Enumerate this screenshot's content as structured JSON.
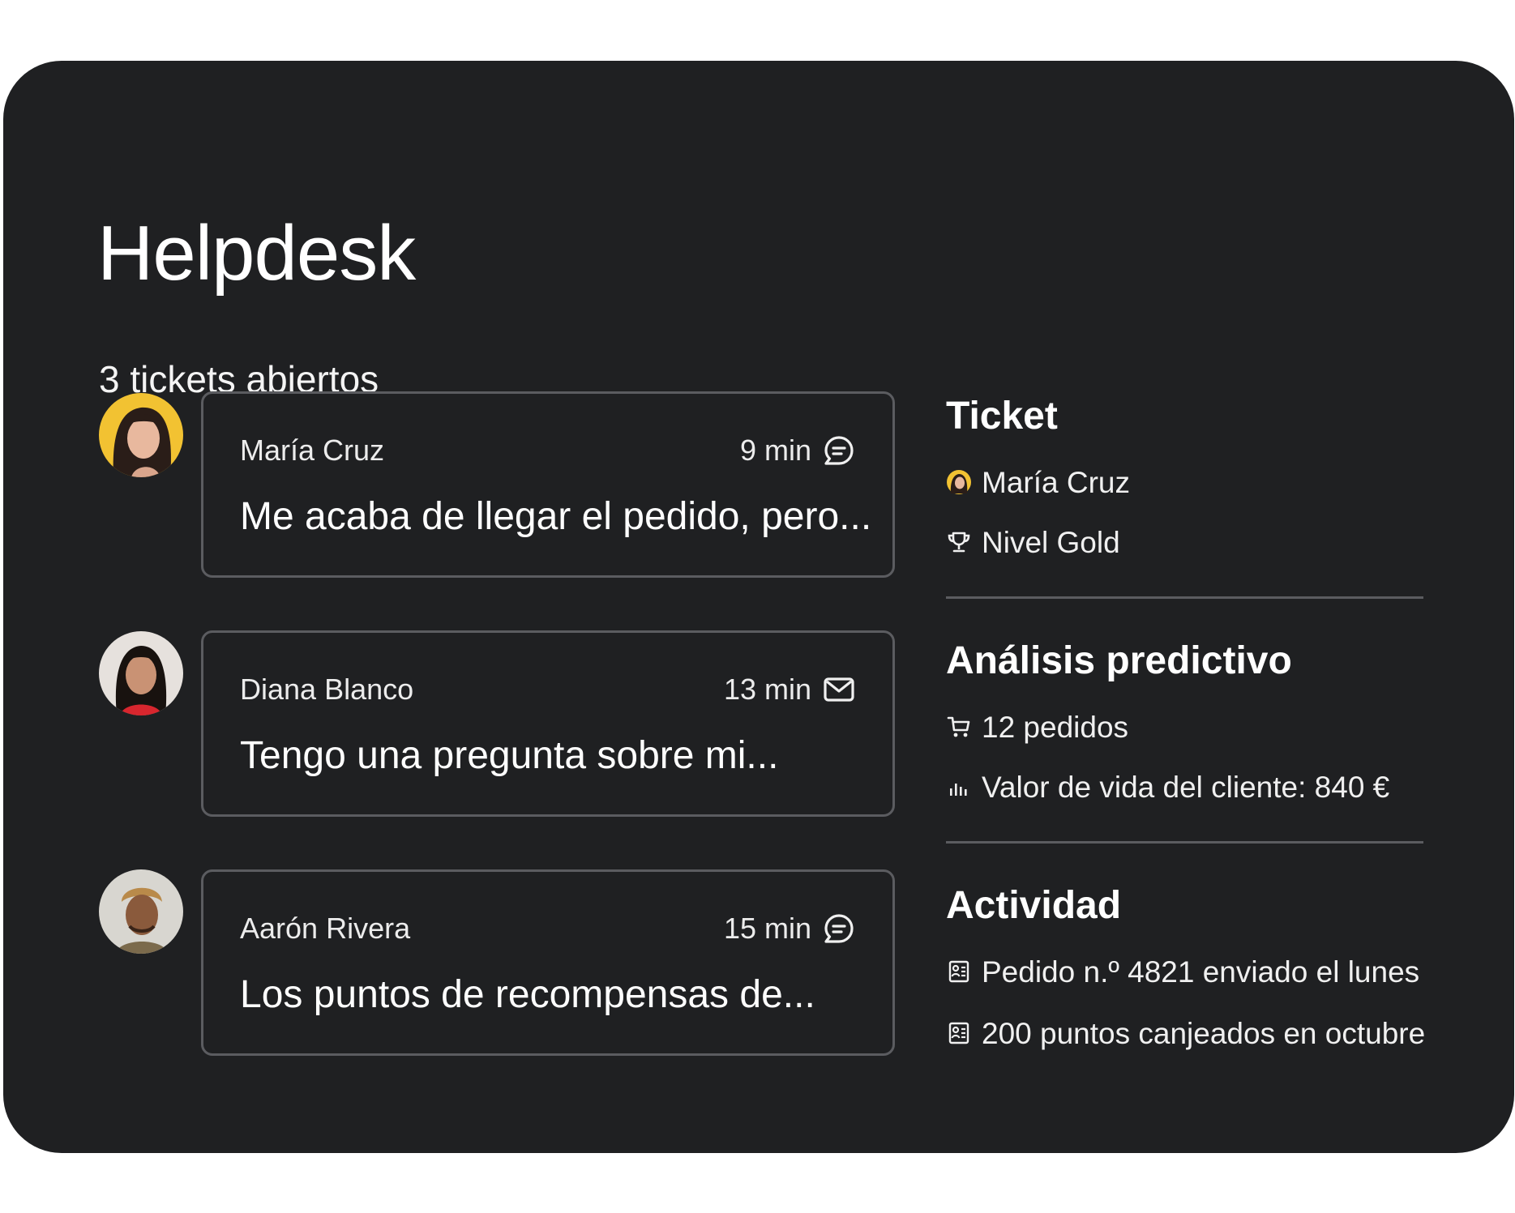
{
  "header": {
    "title": "Helpdesk",
    "subtitle": "3 tickets abiertos"
  },
  "tickets": [
    {
      "name": "María Cruz",
      "time": "9 min",
      "channel_icon": "chat-bubble-icon",
      "preview": "Me acaba de llegar el pedido, pero...",
      "avatar_bg": "#f2c232"
    },
    {
      "name": "Diana Blanco",
      "time": "13 min",
      "channel_icon": "envelope-icon",
      "preview": "Tengo una pregunta sobre mi...",
      "avatar_bg": "#e6e1dd"
    },
    {
      "name": "Aarón Rivera",
      "time": "15 min",
      "channel_icon": "chat-bubble-icon",
      "preview": "Los puntos de recompensas de...",
      "avatar_bg": "#d8d6d0"
    }
  ],
  "details": {
    "ticket": {
      "title": "Ticket",
      "customer": "María Cruz",
      "level": "Nivel Gold"
    },
    "predictive": {
      "title": "Análisis predictivo",
      "orders": "12 pedidos",
      "lifetime_value": "Valor de vida del cliente: 840 €"
    },
    "activity": {
      "title": "Actividad",
      "items": [
        "Pedido n.º 4821 enviado el lunes",
        "200 puntos canjeados en octubre"
      ]
    }
  },
  "colors": {
    "panel_bg": "#1f2022",
    "border": "#5b5c60",
    "text": "#ffffff"
  }
}
